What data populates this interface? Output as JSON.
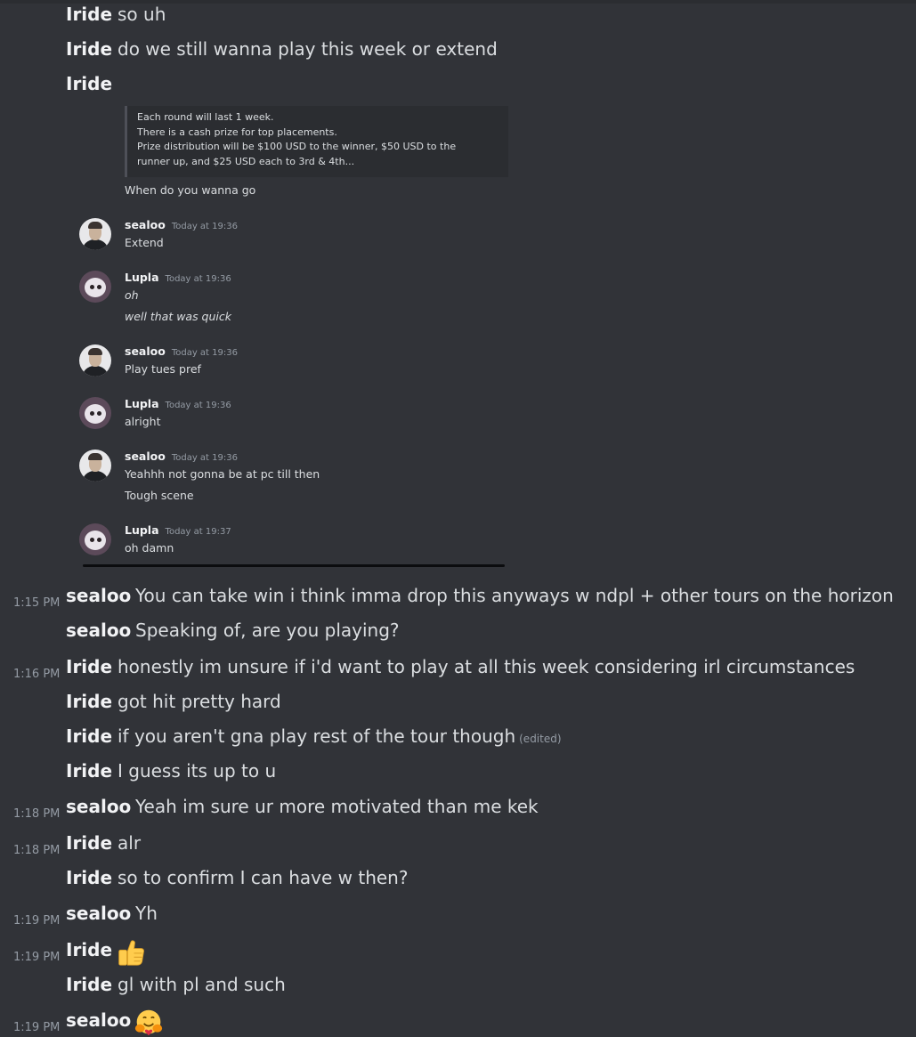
{
  "messages": [
    {
      "time": "",
      "author": "Iride",
      "text": "so uh"
    },
    {
      "time": "",
      "author": "Iride",
      "text": "do we still wanna play this week or extend"
    },
    {
      "time": "",
      "author": "Iride",
      "text": ""
    },
    {
      "time": "1:15 PM",
      "author": "sealoo",
      "text": "You can take win i think imma drop this anyways w ndpl + other tours on the horizon"
    },
    {
      "time": "",
      "author": "sealoo",
      "text": "Speaking of, are you playing?"
    },
    {
      "time": "1:16 PM",
      "author": "Iride",
      "text": "honestly im unsure if i'd want to play at all this week considering irl circumstances"
    },
    {
      "time": "",
      "author": "Iride",
      "text": "got hit pretty hard"
    },
    {
      "time": "",
      "author": "Iride",
      "text": "if you aren't gna play rest of the tour though",
      "edited": "(edited)"
    },
    {
      "time": "",
      "author": "Iride",
      "text": "I guess its up to u"
    },
    {
      "time": "1:18 PM",
      "author": "sealoo",
      "text": "Yeah im sure ur more motivated than me kek"
    },
    {
      "time": "1:18 PM",
      "author": "Iride",
      "text": "alr"
    },
    {
      "time": "",
      "author": "Iride",
      "text": "so to confirm I can have w then?"
    },
    {
      "time": "1:19 PM",
      "author": "sealoo",
      "text": "Yh"
    },
    {
      "time": "1:19 PM",
      "author": "Iride",
      "text": "",
      "emoji": "thumbs-up"
    },
    {
      "time": "",
      "author": "Iride",
      "text": "gl with pl and such"
    },
    {
      "time": "1:19 PM",
      "author": "sealoo",
      "text": "",
      "emoji": "hugging-face"
    }
  ],
  "screenshot": {
    "quote_lines": [
      "Each round will last 1 week.",
      "There is a cash prize for top placements.",
      "Prize distribution will be $100 USD to the winner, $50 USD to the",
      "runner up, and $25 USD each to 3rd & 4th..."
    ],
    "after_quote": "When do you wanna go",
    "messages": [
      {
        "author": "sealoo",
        "time": "Today at 19:36",
        "lines": [
          "Extend"
        ]
      },
      {
        "author": "Lupla",
        "time": "Today at 19:36",
        "lines": [
          "oh",
          "well that was quick"
        ]
      },
      {
        "author": "sealoo",
        "time": "Today at 19:36",
        "lines": [
          "Play tues pref"
        ]
      },
      {
        "author": "Lupla",
        "time": "Today at 19:36",
        "lines": [
          "alright"
        ]
      },
      {
        "author": "sealoo",
        "time": "Today at 19:36",
        "lines": [
          "Yeahhh not gonna be at pc till then",
          "Tough scene"
        ]
      },
      {
        "author": "Lupla",
        "time": "Today at 19:37",
        "lines": [
          "oh damn"
        ]
      }
    ]
  },
  "colors": {
    "background": "#313338",
    "embed_background": "#2b2d31",
    "username": "#f2f3f5",
    "message_text": "#dbdee1",
    "timestamp": "#949ba4"
  }
}
